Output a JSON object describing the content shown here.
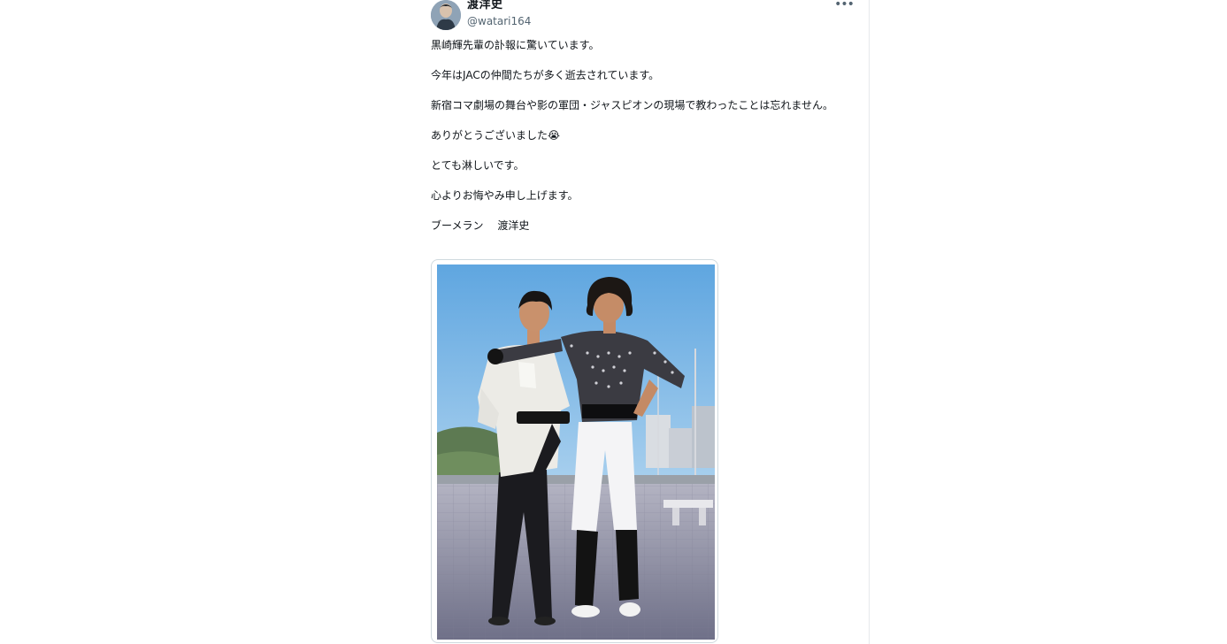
{
  "tweet": {
    "author": {
      "display_name": "渡洋史",
      "handle": "@watari164"
    },
    "more_label": "•••",
    "paragraphs": [
      "黒崎輝先輩の訃報に驚いています。",
      "今年はJACの仲間たちが多く逝去されています。",
      "新宿コマ劇場の舞台や影の軍団・ジャスピオンの現場で教わったことは忘れません。",
      "ありがとうございました😭",
      "とても淋しいです。",
      "心よりお悔やみ申し上げます。",
      "ブーメラン　 渡洋史"
    ],
    "media": {
      "type": "photo",
      "colors": {
        "sky": "#7fb7e6",
        "floor": "#8e8fa6"
      }
    }
  }
}
